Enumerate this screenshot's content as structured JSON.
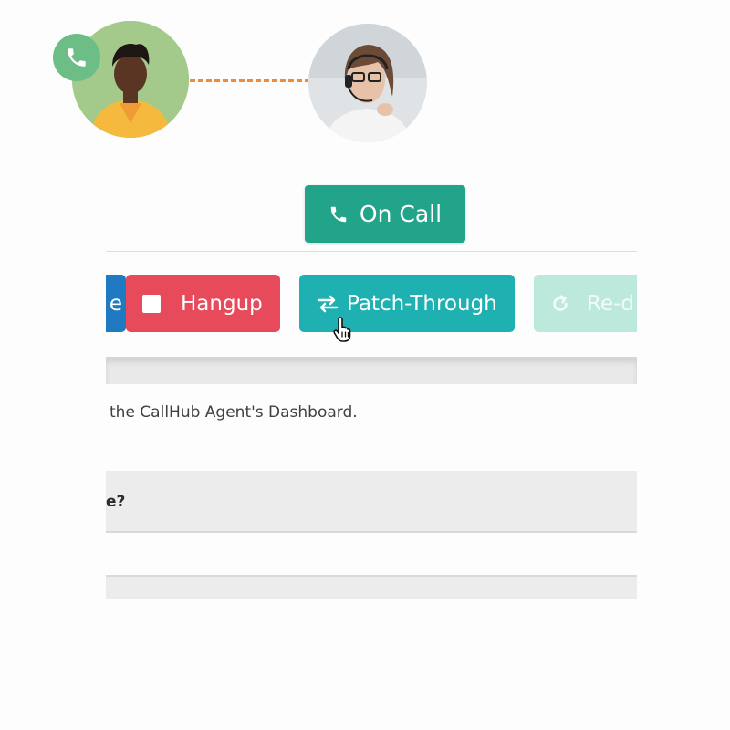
{
  "header": {
    "caller_avatar_icon": "caller-avatar-illustration",
    "agent_avatar_icon": "agent-headset-photo",
    "phone_badge_icon": "phone-icon",
    "connector_color": "#ef8c3b"
  },
  "status": {
    "label": "On Call",
    "icon": "phone-icon",
    "color": "#22a48a"
  },
  "controls": {
    "partial_left_label": "e",
    "hangup_label": "Hangup",
    "patch_label": "Patch-Through",
    "redial_label": "Re-d",
    "colors": {
      "blue": "#1f7ac1",
      "hangup": "#e64a5b",
      "patch": "#1fb0b1",
      "redial": "#bde8dc"
    }
  },
  "content": {
    "intro_text": "the CallHub Agent's Dashboard.",
    "faq_question": "e?"
  }
}
